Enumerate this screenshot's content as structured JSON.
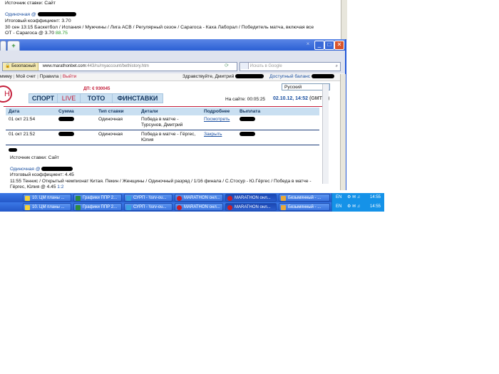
{
  "background_page": {
    "source": "Источник ставки: Сайт",
    "bet_type": "Одиночная @",
    "coef": "Итоговый коэффициент: 3.70",
    "event": "30 сен 13:15 Баскетбол / Испания / Мужчины / Лига АСВ / Регулярный сезон / Сарагоса - Каха Лаборал / Победитель матча, включая все",
    "selection": "ОТ - Сарагоса @ 3.70",
    "selection_green": "88.75"
  },
  "browser": {
    "security_label": "Безопасный",
    "url_domain": "www.marathonbet.com",
    "url_path": ":443/ru/myaccount/bethistory.htm",
    "search_placeholder": "Искать в Google",
    "win_min": "_",
    "win_max": "□",
    "win_close": "✕",
    "new_tab": "+"
  },
  "site": {
    "menu": [
      "ммму",
      "Мой счет",
      "Правила",
      "Выйти"
    ],
    "greeting": "Здравствуйте, Дмитрий",
    "balance_label": "Доступный баланс",
    "account": "ДП: € 930045",
    "nav": [
      "СПОРТ",
      "LIVE",
      "ТОТО",
      "ФИНСТАВКИ"
    ],
    "language": "Русский",
    "on_site": "На сайте: 00:05:25",
    "datetime": "02.10.12, 14:52",
    "timezone": "(GMT+3)",
    "logo_letter": "Н"
  },
  "table": {
    "headers": [
      "Дата",
      "Сумма",
      "Тип ставки",
      "Детали",
      "Подробнее",
      "Выплата"
    ],
    "rows": [
      {
        "date": "01 окт 21:54",
        "type": "Одиночная",
        "details": "Победа в матче - Турсунов, Дмитрий",
        "more": "Посмотреть"
      },
      {
        "date": "01 окт 21:52",
        "type": "Одиночная",
        "details": "Победа в матче - Гёргес, Юлия",
        "more": "Закрыть"
      }
    ]
  },
  "detail": {
    "source": "Источник ставки: Сайт",
    "bet_type": "Одиночная @",
    "coef": "Итоговый коэффициент: 4.45",
    "event": "11:55 Теннис / Открытый чемпионат Китая. Пекин / Женщины / Одиночный разряд / 1/16 финала / С.Стосур - Ю.Гёргес / Победа в матче -",
    "selection": "Гёргес, Юлия @ 4.45",
    "selection_blue": "1:2"
  },
  "taskbar": {
    "items": [
      "10. ЦМ планы ...",
      "Графики ППР 2...",
      "СУРП - \\\\srv-ou...",
      "MARATHON онл...",
      "MARATHON онл...",
      "Безымянный - ..."
    ],
    "lang": "EN",
    "time": "14:55"
  },
  "colors": {
    "accent": "#c41e3a",
    "nav_bg": "#c9dff1",
    "taskbar": "#2458c8",
    "link": "#1a4fa0"
  }
}
